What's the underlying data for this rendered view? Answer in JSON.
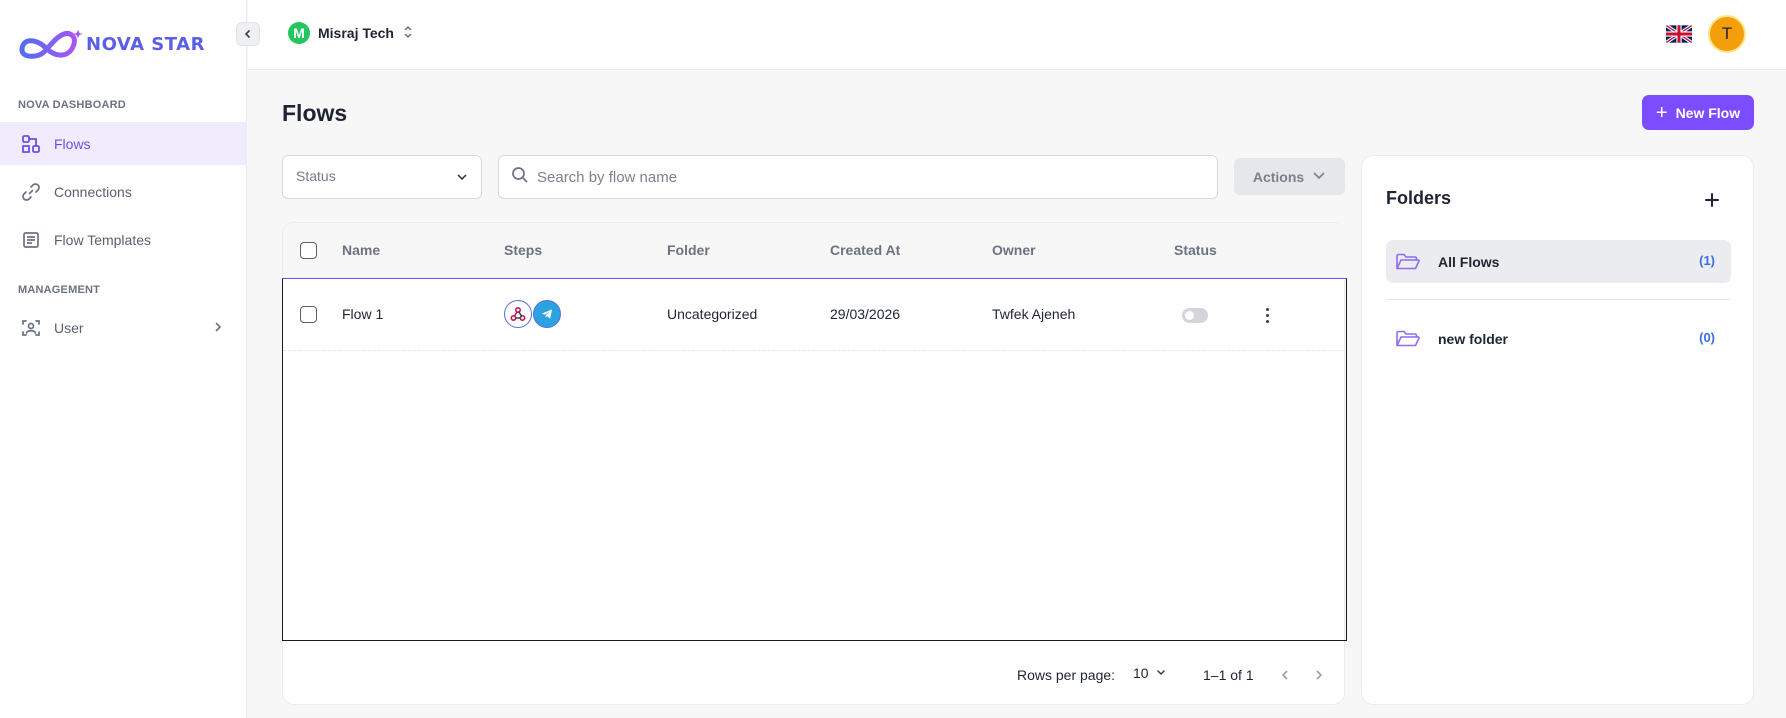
{
  "brand": {
    "name": "NOVA STAR",
    "accent": "#7c4dff"
  },
  "sidebar": {
    "sections": [
      {
        "label": "NOVA DASHBOARD"
      },
      {
        "label": "MANAGEMENT"
      }
    ],
    "items": [
      {
        "label": "Flows",
        "icon": "flows-icon",
        "active": true
      },
      {
        "label": "Connections",
        "icon": "link-icon"
      },
      {
        "label": "Flow Templates",
        "icon": "template-icon"
      },
      {
        "label": "User",
        "icon": "user-scan-icon",
        "expandable": true
      }
    ]
  },
  "header": {
    "workspace": {
      "initial": "M",
      "name": "Misraj Tech"
    },
    "language": "en-GB",
    "avatar_initial": "T"
  },
  "main": {
    "title": "Flows",
    "new_flow_label": "New Flow",
    "filters": {
      "status_placeholder": "Status",
      "search_placeholder": "Search by flow name",
      "actions_label": "Actions"
    },
    "table": {
      "columns": [
        "Name",
        "Steps",
        "Folder",
        "Created At",
        "Owner",
        "Status"
      ],
      "rows": [
        {
          "name": "Flow 1",
          "steps": [
            "webhook-icon",
            "telegram-icon"
          ],
          "folder": "Uncategorized",
          "created_at": "29/03/2026",
          "owner": "Twfek Ajeneh",
          "status_enabled": false
        }
      ]
    },
    "pagination": {
      "rows_per_page_label": "Rows per page:",
      "rows_per_page": "10",
      "range": "1–1 of 1"
    }
  },
  "folders": {
    "title": "Folders",
    "items": [
      {
        "name": "All Flows",
        "count": "(1)",
        "active": true
      },
      {
        "name": "new folder",
        "count": "(0)"
      }
    ]
  }
}
